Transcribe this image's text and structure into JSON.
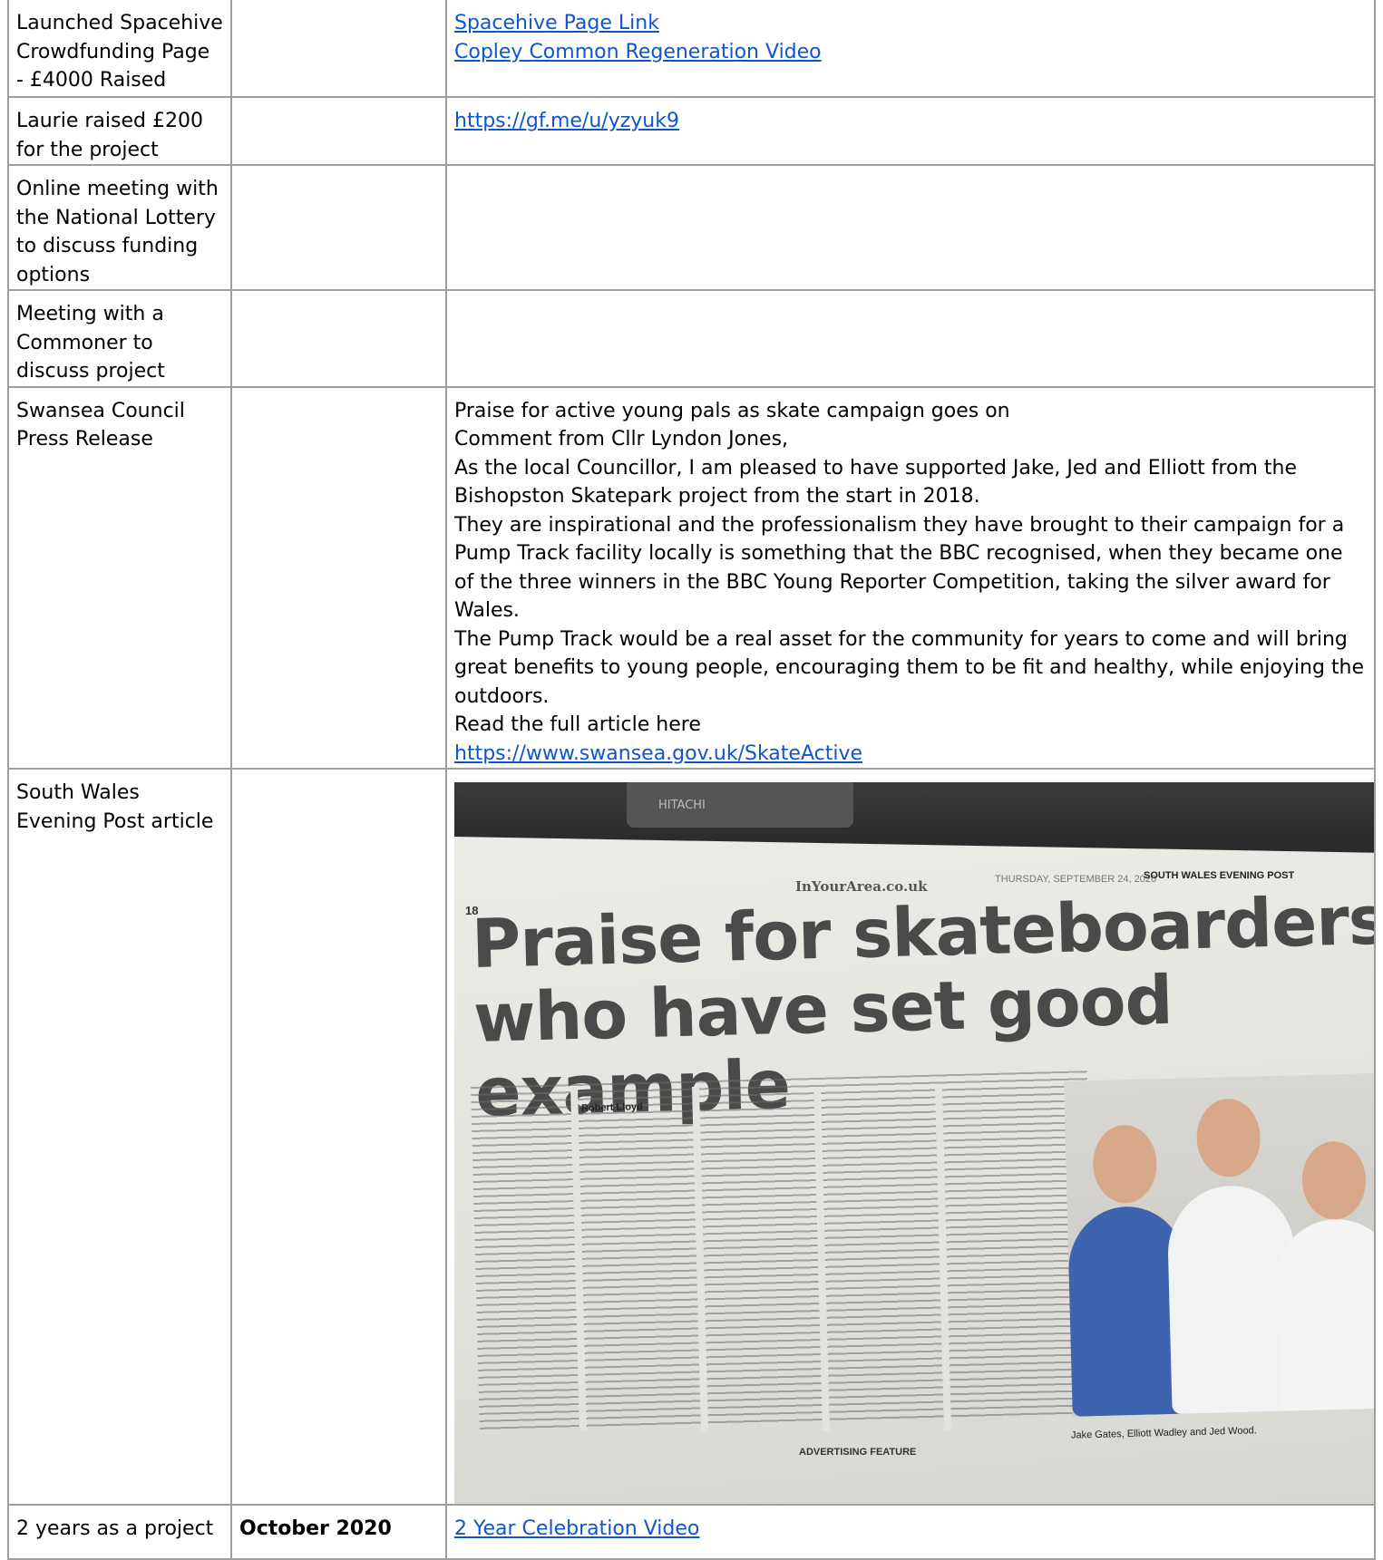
{
  "rows": [
    {
      "event": "Launched Spacehive Crowdfunding Page - £4000 Raised",
      "date": "",
      "links": [
        "Spacehive Page Link",
        "Copley Common Regeneration Video"
      ]
    },
    {
      "event": "Laurie raised £200 for the project",
      "date": "",
      "links": [
        "https://gf.me/u/yzyuk9"
      ]
    },
    {
      "event": "Online meeting with the National Lottery to discuss funding options",
      "date": ""
    },
    {
      "event": "Meeting with a Commoner to discuss project",
      "date": ""
    },
    {
      "event": "Swansea Council Press Release",
      "date": "",
      "paragraphs": [
        "Praise for active young pals as skate campaign goes on",
        "Comment from Cllr Lyndon Jones,",
        "As the local Councillor, I am pleased to have supported Jake, Jed and Elliott from the Bishopston Skatepark project from the start in 2018.",
        "They are inspirational and the professionalism they have brought to their campaign for a Pump Track facility locally is something that the BBC recognised, when they became one of the three winners in the BBC Young Reporter Competition, taking the silver award for Wales.",
        "The Pump Track would be a real asset for the community for years to come and will bring great benefits to young people, encouraging them to be fit and healthy, while enjoying the outdoors.",
        "Read the full article here"
      ],
      "link": "https://www.swansea.gov.uk/SkateActive"
    },
    {
      "event": "South Wales Evening Post article",
      "date": "",
      "clipping": {
        "site": "InYourArea.co.uk",
        "date_line": "THURSDAY, SEPTEMBER 24, 2020",
        "paper": "SOUTH WALES EVENING POST",
        "page_number": "18",
        "headline_line1": "Praise for skateboarders",
        "headline_line2": "who have set good example",
        "byline": "Robert Lloyd",
        "caption": "Jake Gates, Elliott Wadley and Jed Wood.",
        "footer": "ADVERTISING FEATURE",
        "device_label": "HITACHI"
      }
    },
    {
      "event": "2 years as a project",
      "date": "October 2020",
      "links": [
        "2 Year Celebration Video"
      ]
    }
  ],
  "colors": {
    "link": "#1155cc",
    "border": "#9e9e9e"
  }
}
